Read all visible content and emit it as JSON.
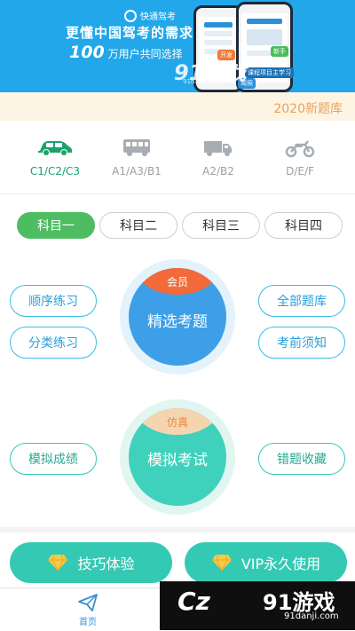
{
  "banner": {
    "brand": "快通驾考",
    "slogan": "更懂中国驾考的需求",
    "users_number": "100",
    "users_text": "万用户共同选择",
    "phone_tags": [
      "开发",
      "新手",
      "驾照"
    ],
    "phone_caption": "课程项目主学习",
    "watermark": "91游戏",
    "watermark_sub": "91danji.com"
  },
  "year_label": "2020新题库",
  "license_types": [
    {
      "label": "C1/C2/C3",
      "icon": "car-icon",
      "active": true
    },
    {
      "label": "A1/A3/B1",
      "icon": "bus-icon",
      "active": false
    },
    {
      "label": "A2/B2",
      "icon": "truck-icon",
      "active": false
    },
    {
      "label": "D/E/F",
      "icon": "motorcycle-icon",
      "active": false
    }
  ],
  "subjects": [
    "科目一",
    "科目二",
    "科目三",
    "科目四"
  ],
  "practice": {
    "left": [
      "顺序练习",
      "分类练习"
    ],
    "right": [
      "全部题库",
      "考前须知"
    ],
    "circle_badge": "会员",
    "circle_title": "精选考题"
  },
  "exam": {
    "left": "模拟成绩",
    "right": "错题收藏",
    "circle_badge": "仿真",
    "circle_title": "模拟考试"
  },
  "actions": [
    {
      "label": "技巧体验",
      "icon": "diamond-icon"
    },
    {
      "label": "VIP永久使用",
      "icon": "diamond-icon"
    }
  ],
  "tabbar": {
    "home": "首页"
  },
  "watermark": {
    "cz": "Cz",
    "logo": "91游戏",
    "domain": "91danji.com"
  },
  "colors": {
    "banner": "#21a7ea",
    "active_green": "#4ebd61",
    "practice_circle": "#3d9fe7",
    "exam_circle": "#3fd1bb",
    "pill_blue": "#36bde6",
    "pill_green": "#34c9b5"
  }
}
